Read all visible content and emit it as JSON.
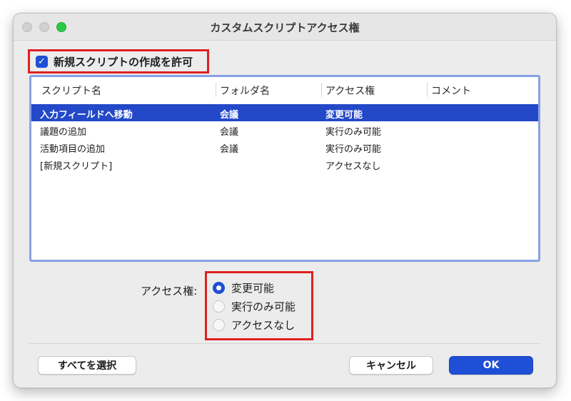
{
  "window": {
    "title": "カスタムスクリプトアクセス権"
  },
  "allow_new": {
    "checked": true,
    "label": "新規スクリプトの作成を許可"
  },
  "table": {
    "columns": [
      "スクリプト名",
      "フォルダ名",
      "アクセス権",
      "コメント"
    ],
    "rows": [
      {
        "name": "入力フィールドへ移動",
        "folder": "会議",
        "access": "変更可能",
        "comment": "",
        "selected": true
      },
      {
        "name": "議題の追加",
        "folder": "会議",
        "access": "実行のみ可能",
        "comment": "",
        "selected": false
      },
      {
        "name": "活動項目の追加",
        "folder": "会議",
        "access": "実行のみ可能",
        "comment": "",
        "selected": false
      },
      {
        "name": "[新規スクリプト]",
        "folder": "",
        "access": "アクセスなし",
        "comment": "",
        "selected": false
      }
    ]
  },
  "access": {
    "label": "アクセス権:",
    "options": [
      "変更可能",
      "実行のみ可能",
      "アクセスなし"
    ],
    "selected_index": 0
  },
  "buttons": {
    "select_all": "すべてを選択",
    "cancel": "キャンセル",
    "ok": "OK"
  },
  "colors": {
    "accent": "#1f4fd6",
    "selection": "#2348c8",
    "highlight_box": "#e02020",
    "zoom_button": "#2ac845"
  }
}
